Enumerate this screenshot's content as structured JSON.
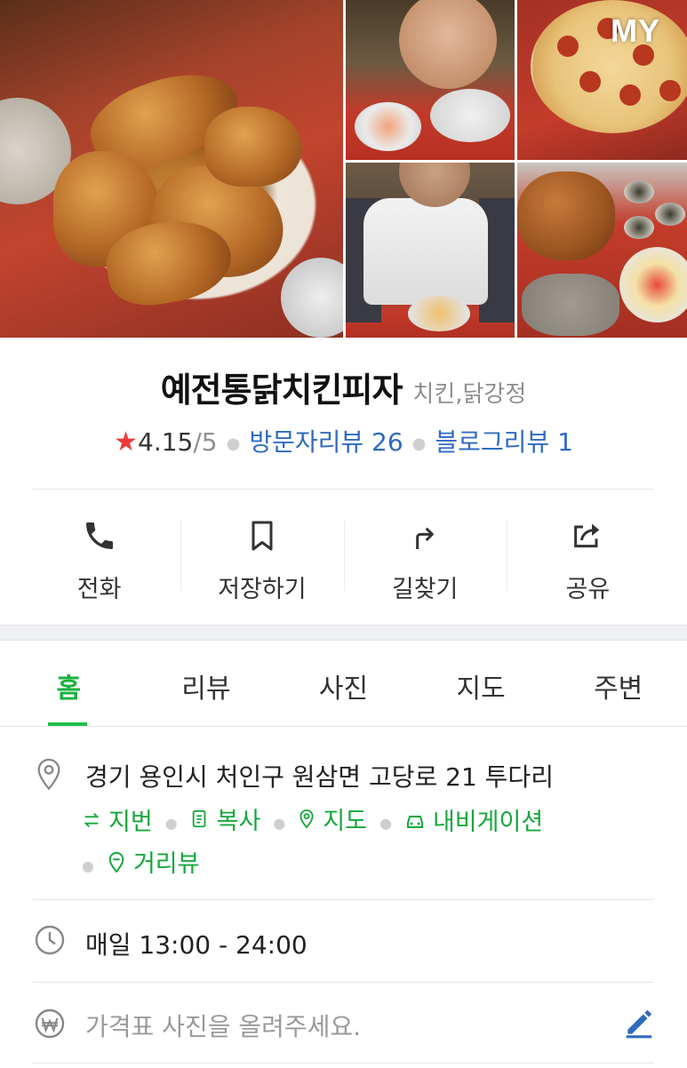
{
  "header": {
    "my_label": "MY"
  },
  "place": {
    "name": "예전통닭치킨피자",
    "category": "치킨,닭강정",
    "rating": "4.15",
    "rating_max": "/5",
    "visitor_reviews": "방문자리뷰 26",
    "blog_reviews": "블로그리뷰 1"
  },
  "actions": [
    {
      "label": "전화",
      "icon": "phone-icon"
    },
    {
      "label": "저장하기",
      "icon": "bookmark-icon"
    },
    {
      "label": "길찾기",
      "icon": "directions-icon"
    },
    {
      "label": "공유",
      "icon": "share-icon"
    }
  ],
  "tabs": [
    {
      "label": "홈",
      "active": true
    },
    {
      "label": "리뷰"
    },
    {
      "label": "사진"
    },
    {
      "label": "지도"
    },
    {
      "label": "주변"
    }
  ],
  "address": {
    "text": "경기 용인시 처인구 원삼면 고당로 21 투다리",
    "links": [
      "지번",
      "복사",
      "지도",
      "내비게이션",
      "거리뷰"
    ]
  },
  "hours": {
    "text": "매일 13:00 - 24:00"
  },
  "price": {
    "placeholder": "가격표 사진을 올려주세요."
  },
  "colors": {
    "accent_green": "#1fc04a",
    "link_blue": "#2f6bbf",
    "star_red": "#ea3b3b"
  }
}
